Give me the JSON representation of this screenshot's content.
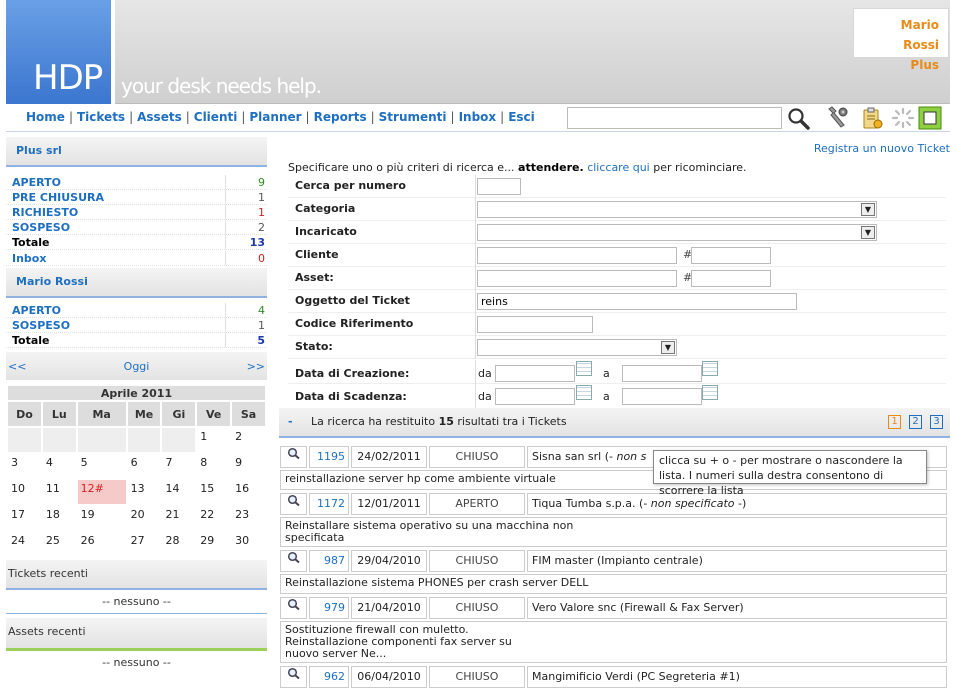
{
  "header": {
    "logo": "HDP",
    "tagline": "your desk needs help.",
    "user_name": "Mario Rossi",
    "user_plan": "Plus"
  },
  "nav": {
    "links": [
      "Home",
      "Tickets",
      "Assets",
      "Clienti",
      "Planner",
      "Reports",
      "Strumenti",
      "Inbox",
      "Esci"
    ],
    "search_value": ""
  },
  "sidebar": {
    "org_title": "Plus srl",
    "org_stats": [
      {
        "label": "APERTO",
        "value": "9",
        "color": "#2e8b22"
      },
      {
        "label": "PRE CHIUSURA",
        "value": "1",
        "color": "#555555"
      },
      {
        "label": "RICHIESTO",
        "value": "1",
        "color": "#d02020"
      },
      {
        "label": "SOSPESO",
        "value": "2",
        "color": "#555555"
      }
    ],
    "org_total_label": "Totale",
    "org_total_value": "13",
    "inbox_label": "Inbox",
    "inbox_value": "0",
    "user_title": "Mario Rossi",
    "user_stats": [
      {
        "label": "APERTO",
        "value": "4",
        "color": "#2e8b22"
      },
      {
        "label": "SOSPESO",
        "value": "1",
        "color": "#555555"
      }
    ],
    "user_total_label": "Totale",
    "user_total_value": "5",
    "cal_prev": "<<",
    "cal_today": "Oggi",
    "cal_next": ">>",
    "calendar": {
      "month": "Aprile 2011",
      "weekdays": [
        "Do",
        "Lu",
        "Ma",
        "Me",
        "Gi",
        "Ve",
        "Sa"
      ],
      "weeks": [
        [
          "",
          "",
          "",
          "",
          "",
          "1",
          "2"
        ],
        [
          "3",
          "4",
          "5",
          "6",
          "7",
          "8",
          "9"
        ],
        [
          "10",
          "11",
          "12#",
          "13",
          "14",
          "15",
          "16"
        ],
        [
          "17",
          "18",
          "19",
          "20",
          "21",
          "22",
          "23"
        ],
        [
          "24",
          "25",
          "26",
          "27",
          "28",
          "29",
          "30"
        ]
      ],
      "today": "12#"
    },
    "recent_tickets_title": "Tickets recenti",
    "recent_tickets_empty": "-- nessuno --",
    "recent_assets_title": "Assets recenti",
    "recent_assets_empty": "-- nessuno --"
  },
  "main": {
    "register_link": "Registra un nuovo Ticket",
    "instr_pre": "Specificare uno o più criteri di ricerca e... ",
    "instr_bold": "attendere.",
    "instr_link": "cliccare qui",
    "instr_post": " per ricominciare.",
    "form": {
      "cerca_numero": "Cerca per numero",
      "categoria": "Categoria",
      "incaricato": "Incaricato",
      "cliente": "Cliente",
      "asset": "Asset:",
      "oggetto": "Oggetto del Ticket",
      "oggetto_value": "reins",
      "codice": "Codice Riferimento",
      "stato": "Stato:",
      "data_creazione": "Data di Creazione:",
      "data_scadenza": "Data di Scadenza:",
      "hash": "#",
      "da": "da",
      "a": "a"
    },
    "results": {
      "toggle": "-",
      "text_pre": "La ricerca ha restituito ",
      "count": "15",
      "text_post": " risultati tra i Tickets",
      "pages": [
        "1",
        "2",
        "3"
      ]
    },
    "tickets": [
      {
        "id": "1195",
        "date": "24/02/2011",
        "state": "CHIUSO",
        "client": "Sisna san srl (- ",
        "client_note": "non s",
        "client_end": "",
        "desc": "reinstallazione server hp come ambiente virtuale"
      },
      {
        "id": "1172",
        "date": "12/01/2011",
        "state": "APERTO",
        "client": "Tiqua Tumba s.p.a. (- ",
        "client_note": "non specificato",
        "client_end": " -)",
        "desc": "Reinstallare sistema operativo su una macchina non\nspecificata"
      },
      {
        "id": "987",
        "date": "29/04/2010",
        "state": "CHIUSO",
        "client": "FIM master (Impianto centrale)",
        "client_note": "",
        "client_end": "",
        "desc": "Reinstallazione sistema PHONES per crash server DELL"
      },
      {
        "id": "979",
        "date": "21/04/2010",
        "state": "CHIUSO",
        "client": "Vero Valore snc (Firewall & Fax Server)",
        "client_note": "",
        "client_end": "",
        "desc": "Sostituzione firewall con muletto.\nReinstallazione componenti fax server su\nnuovo server Ne..."
      },
      {
        "id": "962",
        "date": "06/04/2010",
        "state": "CHIUSO",
        "client": "Mangimificio Verdi (PC Segreteria #1)",
        "client_note": "",
        "client_end": "",
        "desc": ""
      }
    ],
    "tooltip": "clicca su + o - per mostrare o nascondere la lista. I numeri sulla destra consentono di scorrere la lista"
  }
}
